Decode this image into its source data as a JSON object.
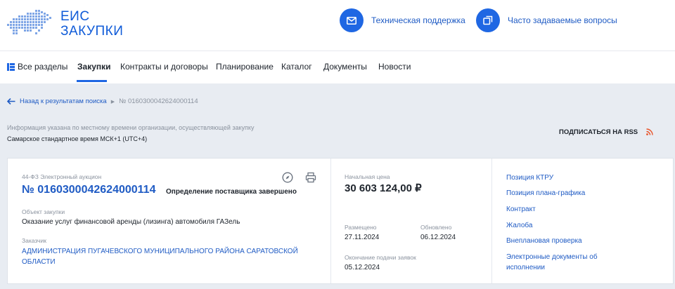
{
  "header": {
    "logo_line1": "ЕИС",
    "logo_line2": "ЗАКУПКИ",
    "support_label": "Техническая поддержка",
    "faq_label": "Часто задаваемые вопросы"
  },
  "nav": {
    "items": [
      "Все разделы",
      "Закупки",
      "Контракты и договоры",
      "Планирование",
      "Каталог",
      "Документы",
      "Новости"
    ],
    "active": "Закупки"
  },
  "breadcrumb": {
    "back_label": "Назад к результатам поиска",
    "current": "№ 0160300042624000114"
  },
  "info": {
    "tz_note": "Информация указана по местному времени организации, осуществляющей закупку",
    "tz": "Самарское стандартное время МСК+1 (UTC+4)",
    "rss_label": "ПОДПИСАТЬСЯ НА RSS"
  },
  "purchase": {
    "law_type": "44-ФЗ Электронный аукцион",
    "number": "№ 0160300042624000114",
    "status": "Определение поставщика завершено",
    "object_label": "Объект закупки",
    "object_value": "Оказание услуг финансовой аренды (лизинга) автомобиля ГАЗель",
    "customer_label": "Заказчик",
    "customer_line1": "АДМИНИСТРАЦИЯ ПУГАЧЕВСКОГО МУНИЦИПАЛЬНОГО РАЙОНА САРАТОВСКОЙ",
    "customer_line2": "ОБЛАСТИ",
    "price_label": "Начальная цена",
    "price_value": "30 603 124,00 ₽",
    "placed_label": "Размещено",
    "placed_value": "27.11.2024",
    "updated_label": "Обновлено",
    "updated_value": "06.12.2024",
    "deadline_label": "Окончание подачи заявок",
    "deadline_value": "05.12.2024"
  },
  "side_links": [
    "Позиция КТРУ",
    "Позиция плана-графика",
    "Контракт",
    "Жалоба",
    "Внеплановая проверка",
    "Электронные документы об",
    "исполнении"
  ],
  "colors": {
    "accent": "#1f67e3",
    "link": "#1f5bc4",
    "rss": "#e8542a",
    "background": "#e8ecf2"
  },
  "icons": {
    "support": "mail-icon",
    "faq": "copy-icon",
    "nav_all": "sections-icon",
    "back": "arrow-left-icon",
    "card_link": "compass-icon",
    "card_print": "printer-icon",
    "rss": "rss-icon"
  }
}
